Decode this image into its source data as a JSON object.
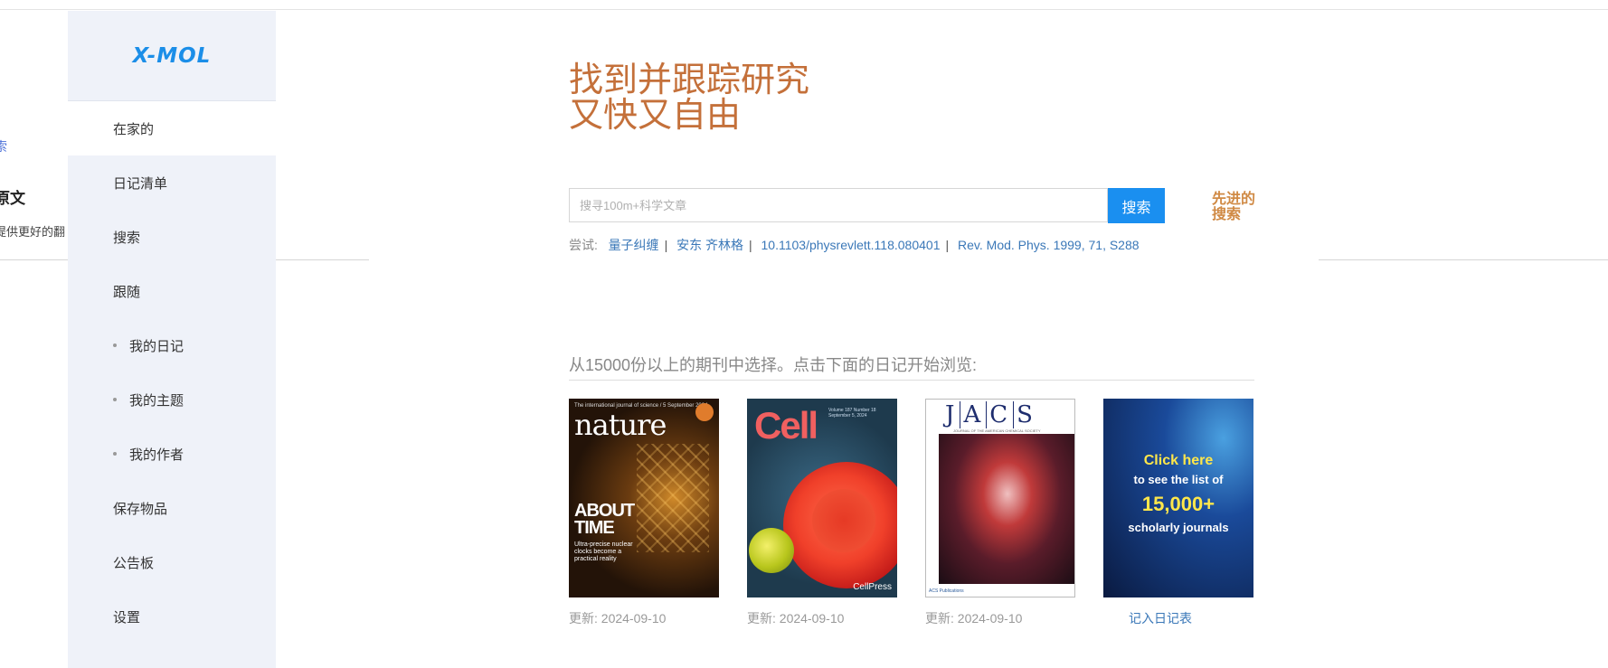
{
  "background": {
    "fragment_1": "索",
    "fragment_2": "原文",
    "fragment_3": "提供更好的翻"
  },
  "sidebar": {
    "logo": "X-MOL",
    "items": [
      {
        "label": "在家的",
        "active": true
      },
      {
        "label": "日记清单"
      },
      {
        "label": "搜索"
      },
      {
        "label": "跟随"
      },
      {
        "label": "我的日记",
        "sub": true
      },
      {
        "label": "我的主题",
        "sub": true
      },
      {
        "label": "我的作者",
        "sub": true
      },
      {
        "label": "保存物品"
      },
      {
        "label": "公告板"
      },
      {
        "label": "设置"
      }
    ]
  },
  "hero": {
    "line1": "找到并跟踪研究",
    "line2": "又快又自由"
  },
  "search": {
    "placeholder": "搜寻100m+科学文章",
    "button": "搜索",
    "advanced_line1": "先进的",
    "advanced_line2": "搜索"
  },
  "try": {
    "label": "尝试:",
    "items": [
      "量子纠缠",
      "安东 齐林格",
      "10.1103/physrevlett.118.080401",
      "Rev. Mod. Phys. 1999, 71, S288"
    ]
  },
  "journals": {
    "title": "从15000份以上的期刊中选择。点击下面的日记开始浏览:",
    "covers": [
      {
        "name": "nature",
        "updated": "更新: 2024-09-10"
      },
      {
        "name": "Cell",
        "updated": "更新: 2024-09-10"
      },
      {
        "name": "JACS",
        "updated": "更新: 2024-09-10"
      },
      {
        "name": "more",
        "updated": "记入日记表"
      }
    ],
    "nature_cover": {
      "topline": "The international journal of science / 5 September 2024",
      "masthead": "nature",
      "headline_1": "ABOUT",
      "headline_2": "TIME",
      "blurb": "Ultra-precise nuclear clocks become a practical reality"
    },
    "cell_cover": {
      "masthead": "Cell",
      "meta": "Volume 187 Number 18 September 5, 2024",
      "press": "CellPress"
    },
    "jacs_cover": {
      "l1": "J",
      "l2": "A",
      "l3": "C",
      "l4": "S",
      "subtitle": "JOURNAL OF THE AMERICAN CHEMICAL SOCIETY",
      "footer": "ACS Publications"
    },
    "more_cover": {
      "line1": "Click here",
      "line2": "to see the list of",
      "line3": "15,000+",
      "line4": "scholarly journals"
    }
  }
}
